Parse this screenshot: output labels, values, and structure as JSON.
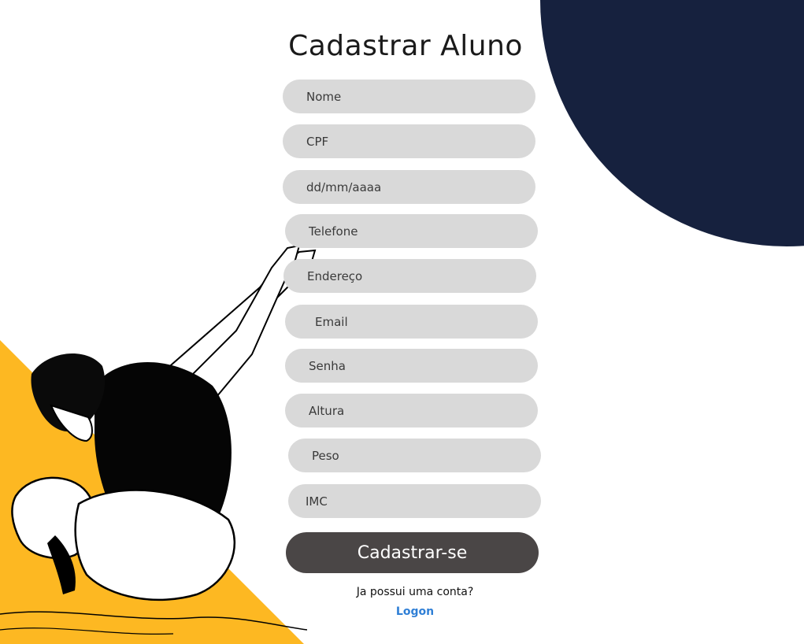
{
  "page": {
    "title": "Cadastrar Aluno"
  },
  "colors": {
    "navy": "#16213e",
    "yellow": "#fdb822",
    "field_bg": "#d9d9d9",
    "button_bg": "#4a4646",
    "link": "#2f7fd6"
  },
  "form": {
    "fields": [
      {
        "name": "nome-field",
        "placeholder": "Nome"
      },
      {
        "name": "cpf-field",
        "placeholder": "CPF"
      },
      {
        "name": "birthdate-field",
        "placeholder": "dd/mm/aaaa"
      },
      {
        "name": "telefone-field",
        "placeholder": "Telefone"
      },
      {
        "name": "endereco-field",
        "placeholder": "Endereço"
      },
      {
        "name": "email-field",
        "placeholder": "Email"
      },
      {
        "name": "senha-field",
        "placeholder": "Senha"
      },
      {
        "name": "altura-field",
        "placeholder": "Altura"
      },
      {
        "name": "peso-field",
        "placeholder": "Peso"
      },
      {
        "name": "imc-field",
        "placeholder": "IMC"
      }
    ],
    "submit_label": "Cadastrar-se",
    "have_account_text": "Ja possui uma conta?",
    "logon_label": "Logon"
  },
  "illustration": {
    "icon": "manga-fighter-illustration"
  }
}
